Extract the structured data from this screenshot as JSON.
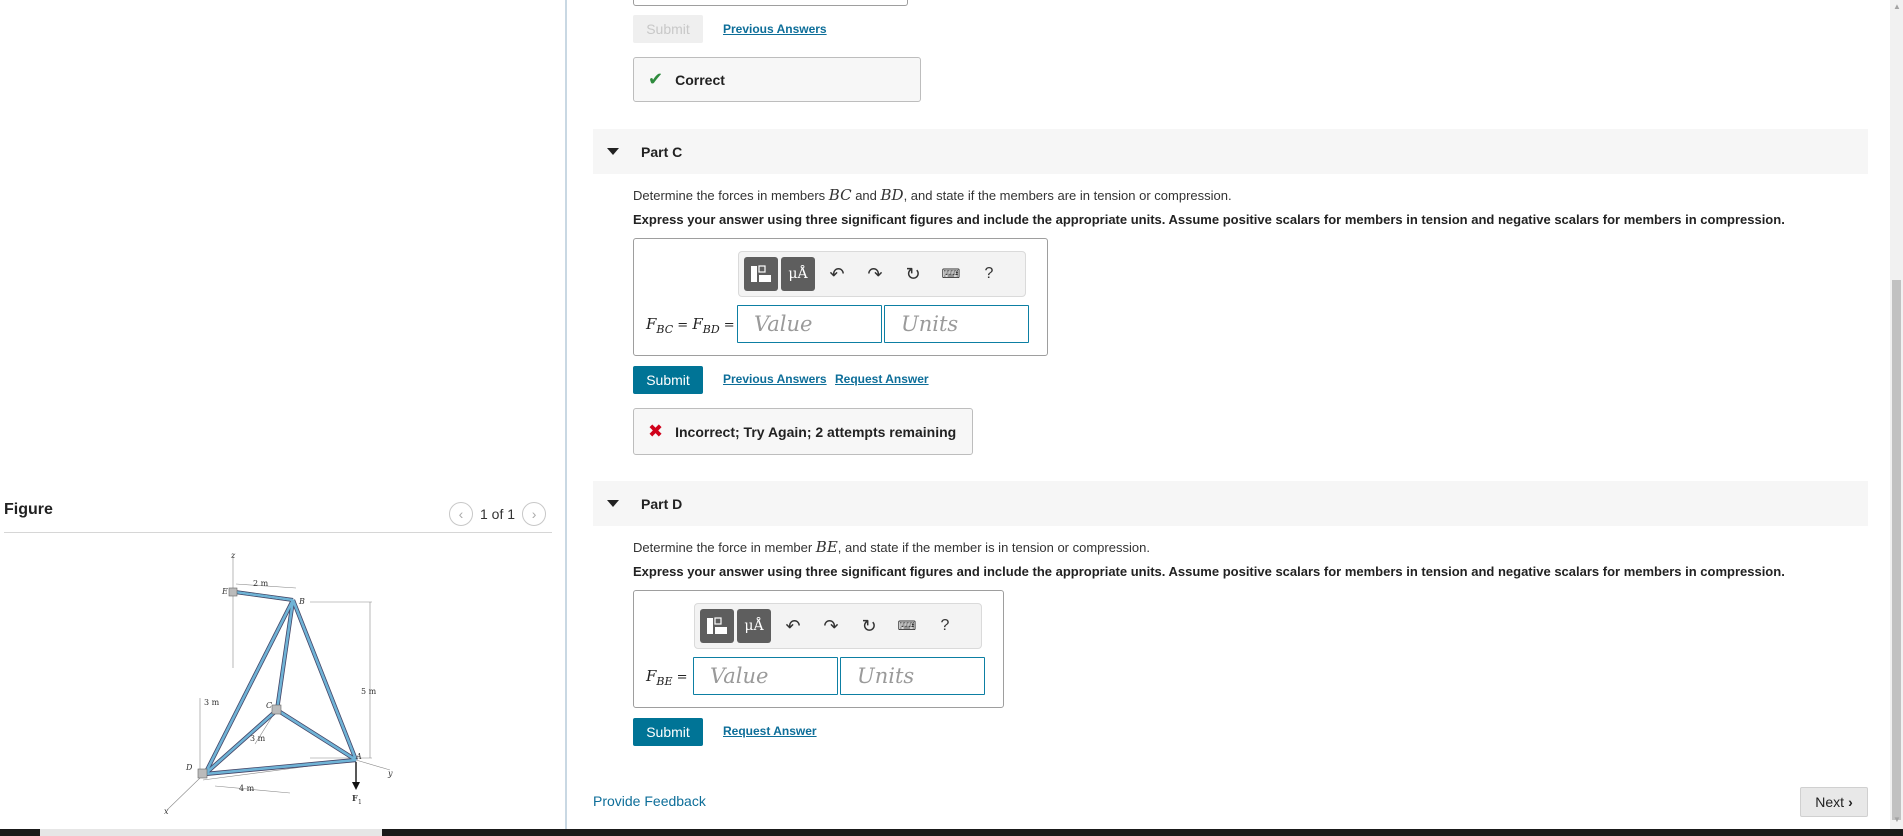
{
  "top": {
    "submit_label": "Submit",
    "previous_answers_label": "Previous Answers",
    "feedback_text": "Correct",
    "feedback_icon": "check-icon",
    "feedback_color": "#2e8b3d"
  },
  "part_c": {
    "title": "Part C",
    "question_pre": "Determine the forces in members ",
    "var1": "BC",
    "question_mid": " and ",
    "var2": "BD",
    "question_post": ", and state if the members are in tension or compression.",
    "instructions": "Express your answer using three significant figures and include the appropriate units. Assume positive scalars for members in tension and negative scalars for members in compression.",
    "label_f1": "F",
    "label_sub1": "BC",
    "label_eq1": " = ",
    "label_f2": "F",
    "label_sub2": "BD",
    "label_eq2": " =",
    "value_placeholder": "Value",
    "units_placeholder": "Units",
    "submit_label": "Submit",
    "previous_answers_label": "Previous Answers",
    "request_answer_label": "Request Answer",
    "feedback_text": "Incorrect; Try Again; 2 attempts remaining",
    "feedback_icon": "x-icon",
    "feedback_color": "#d0021b"
  },
  "part_d": {
    "title": "Part D",
    "question_pre": "Determine the force in member ",
    "var1": "BE",
    "question_post": ", and state if the member is in tension or compression.",
    "instructions": "Express your answer using three significant figures and include the appropriate units. Assume positive scalars for members in tension and negative scalars for members in compression.",
    "label_f": "F",
    "label_sub": "BE",
    "label_eq": " =",
    "value_placeholder": "Value",
    "units_placeholder": "Units",
    "submit_label": "Submit",
    "request_answer_label": "Request Answer"
  },
  "toolbar": {
    "templates_icon": "templates-icon",
    "units_symbol": "μÅ",
    "undo_icon": "undo-icon",
    "redo_icon": "redo-icon",
    "reset_icon": "reset-icon",
    "keyboard_icon": "keyboard-icon",
    "help_label": "?"
  },
  "figure": {
    "title": "Figure",
    "pager": "1 of 1",
    "labels": {
      "z": "z",
      "e": "E",
      "b": "B",
      "c": "C",
      "d": "D",
      "a": "A",
      "x": "x",
      "y": "y",
      "f1": "F",
      "f1_sub": "1",
      "dim_2m": "2 m",
      "dim_3m_left": "3 m",
      "dim_3m_mid": "3 m",
      "dim_5m": "5 m",
      "dim_4m": "4 m"
    },
    "member_color": "#6fb3d6"
  },
  "footer": {
    "provide_feedback_label": "Provide Feedback",
    "next_label": "Next"
  }
}
